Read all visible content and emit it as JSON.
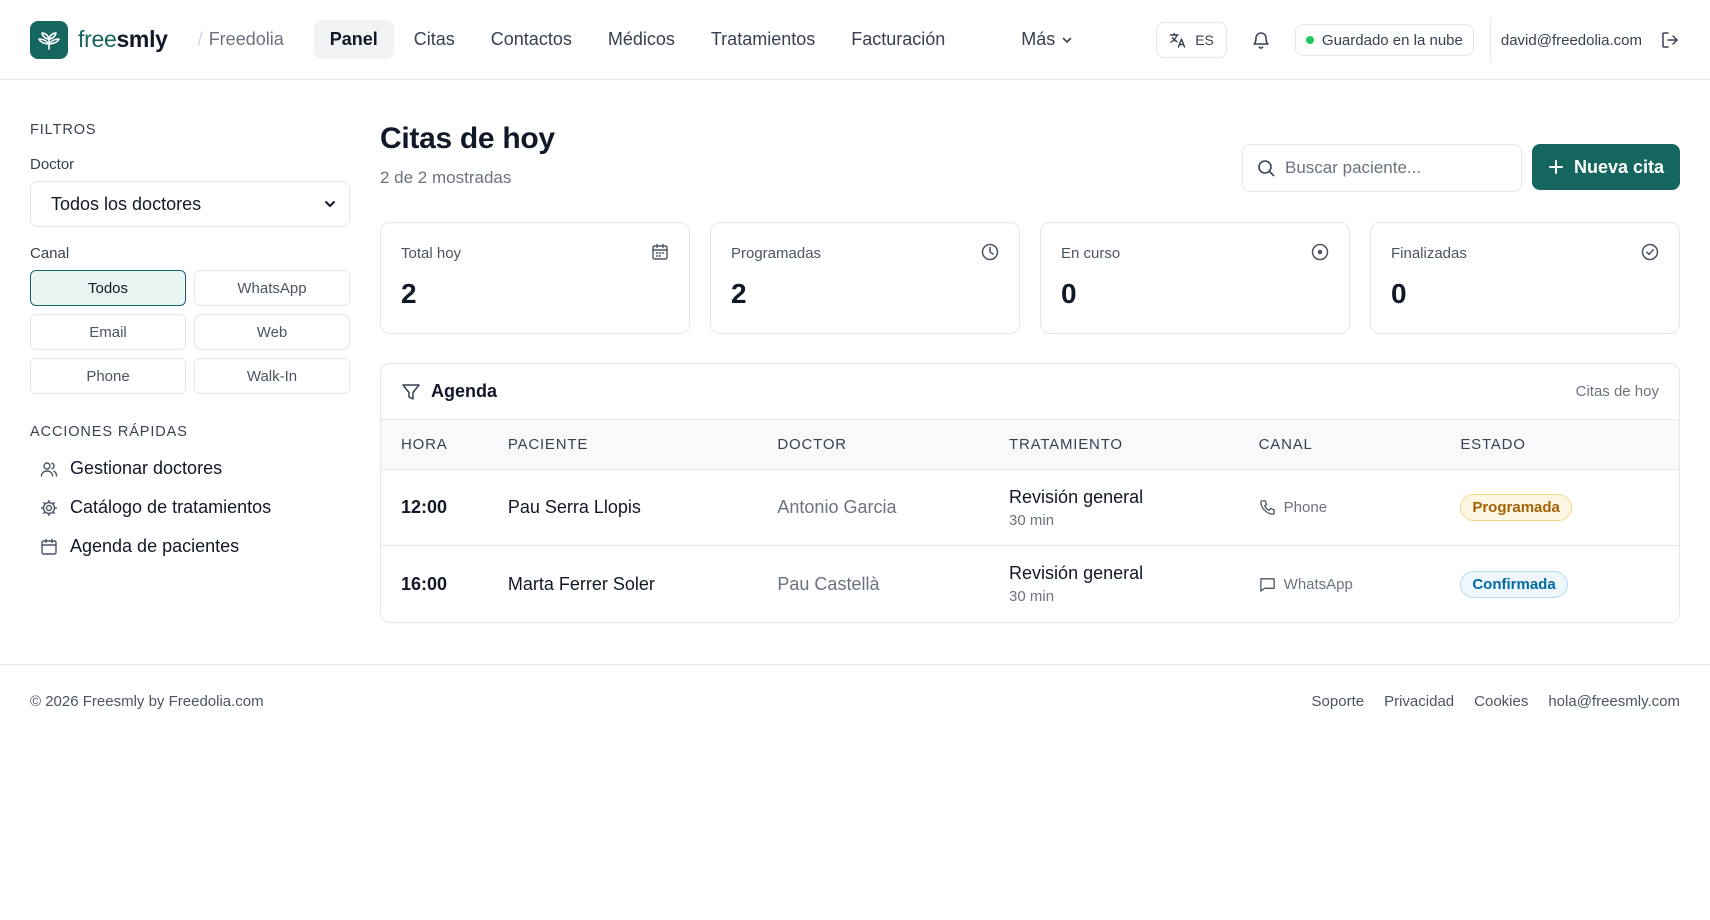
{
  "header": {
    "brand_free": "free",
    "brand_smly": "smly",
    "org": "Freedolia",
    "nav": [
      "Panel",
      "Citas",
      "Contactos",
      "Médicos",
      "Tratamientos",
      "Facturación"
    ],
    "more": "Más",
    "lang": "ES",
    "cloud_status": "Guardado en la nube",
    "user_email": "david@freedolia.com"
  },
  "sidebar": {
    "filters_title": "FILTROS",
    "doctor_label": "Doctor",
    "doctor_selected": "Todos los doctores",
    "channel_label": "Canal",
    "channels": [
      "Todos",
      "WhatsApp",
      "Email",
      "Web",
      "Phone",
      "Walk-In"
    ],
    "active_channel": "Todos",
    "quick_actions_title": "ACCIONES RÁPIDAS",
    "quick_actions": [
      {
        "label": "Gestionar doctores",
        "icon": "users-icon"
      },
      {
        "label": "Catálogo de tratamientos",
        "icon": "gear-icon"
      },
      {
        "label": "Agenda de pacientes",
        "icon": "calendar-icon"
      }
    ]
  },
  "main": {
    "title": "Citas de hoy",
    "subtitle": "2 de 2 mostradas",
    "search_placeholder": "Buscar paciente...",
    "new_button": "Nueva cita",
    "stats": [
      {
        "label": "Total hoy",
        "value": "2",
        "icon": "calendar-icon"
      },
      {
        "label": "Programadas",
        "value": "2",
        "icon": "clock-icon"
      },
      {
        "label": "En curso",
        "value": "0",
        "icon": "target-icon"
      },
      {
        "label": "Finalizadas",
        "value": "0",
        "icon": "check-circle-icon"
      }
    ],
    "agenda": {
      "title": "Agenda",
      "tag": "Citas de hoy",
      "columns": [
        "HORA",
        "PACIENTE",
        "DOCTOR",
        "TRATAMIENTO",
        "CANAL",
        "ESTADO"
      ],
      "rows": [
        {
          "time": "12:00",
          "patient": "Pau Serra Llopis",
          "doctor": "Antonio Garcia",
          "treatment": "Revisión general",
          "duration": "30 min",
          "channel": "Phone",
          "channel_icon": "phone-icon",
          "status": "Programada"
        },
        {
          "time": "16:00",
          "patient": "Marta Ferrer Soler",
          "doctor": "Pau Castellà",
          "treatment": "Revisión general",
          "duration": "30 min",
          "channel": "WhatsApp",
          "channel_icon": "message-icon",
          "status": "Confirmada"
        }
      ]
    }
  },
  "footer": {
    "copyright": "© 2026 Freesmly by Freedolia.com",
    "links": [
      "Soporte",
      "Privacidad",
      "Cookies",
      "hola@freesmly.com"
    ]
  },
  "colors": {
    "brand": "#14665e",
    "status_programada": "#a16207",
    "status_confirmada": "#0369a1",
    "cloud_dot": "#22c55e"
  }
}
